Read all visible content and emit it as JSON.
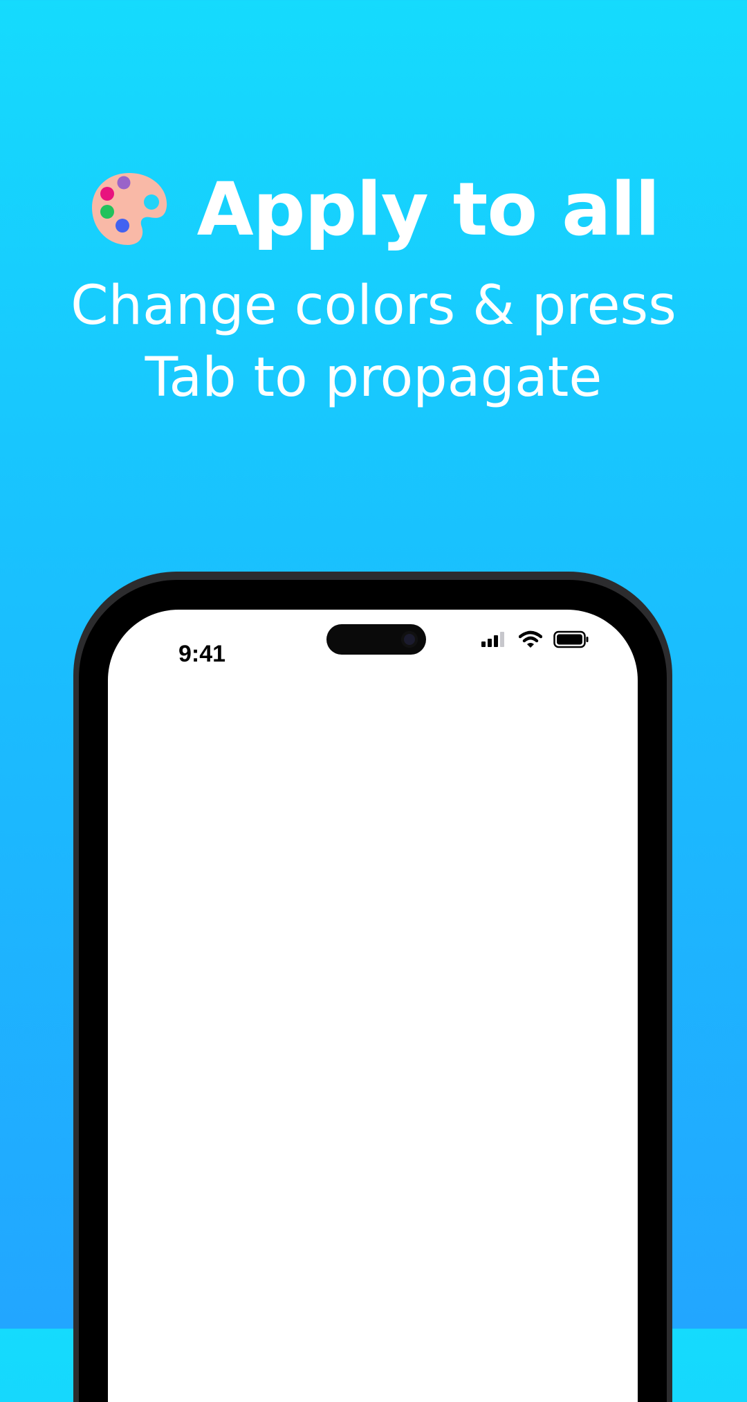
{
  "headline": {
    "icon": "palette-icon",
    "title": "Apply to all"
  },
  "subtitle": {
    "line1": "Change colors & press",
    "line2": "Tab to propagate"
  },
  "phone": {
    "status_bar": {
      "time": "9:41",
      "icons": [
        "signal-icon",
        "wifi-icon",
        "battery-icon"
      ]
    }
  },
  "colors": {
    "background_top": "#15dbfd",
    "background_bottom": "#22a6ff",
    "text": "#ffffff",
    "phone_frame": "#2c2c2e",
    "palette_base": "#f9b9a7"
  }
}
